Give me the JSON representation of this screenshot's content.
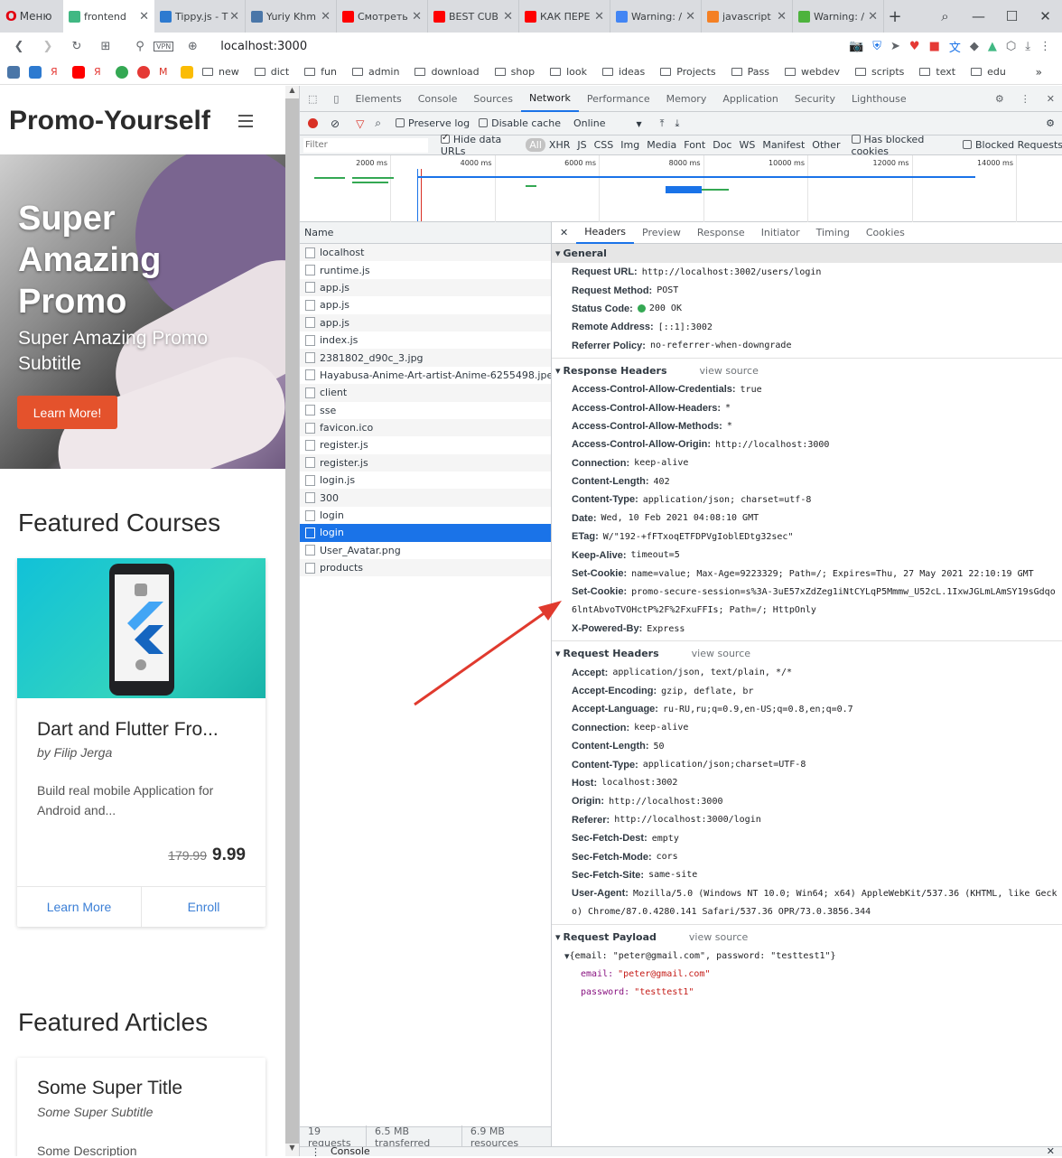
{
  "browser": {
    "menu_label": "Меню",
    "tabs": [
      {
        "title": "frontend",
        "color": "#41b883",
        "active": true
      },
      {
        "title": "Tippy.js - T",
        "color": "#2d7ad0"
      },
      {
        "title": "Yuriy Khm",
        "color": "#4a76a8"
      },
      {
        "title": "Смотреть",
        "color": "#ff0000"
      },
      {
        "title": "BEST CUB",
        "color": "#ff0000"
      },
      {
        "title": "КАК ПЕРЕ",
        "color": "#ff0000"
      },
      {
        "title": "Warning: /",
        "color": "#4285f4"
      },
      {
        "title": "javascript",
        "color": "#f48024"
      },
      {
        "title": "Warning: /",
        "color": "#4db33d"
      }
    ],
    "url": "localhost:3000",
    "vpn_label": "VPN",
    "bookmark_folders": [
      "new",
      "dict",
      "fun",
      "admin",
      "download",
      "shop",
      "look",
      "ideas",
      "Projects",
      "Pass",
      "webdev",
      "scripts",
      "text",
      "edu"
    ]
  },
  "page": {
    "logo": "Promo-Yourself",
    "hero_title": "Super Amazing Promo",
    "hero_subtitle": "Super Amazing Promo Subtitle",
    "hero_button": "Learn More!",
    "courses_heading": "Featured Courses",
    "course": {
      "title": "Dart and Flutter Fro...",
      "author": "by Filip Jerga",
      "description": "Build real mobile Application for Android and...",
      "old_price": "179.99",
      "price": "9.99",
      "learn_more": "Learn More",
      "enroll": "Enroll"
    },
    "articles_heading": "Featured Articles",
    "article": {
      "title": "Some Super Title",
      "subtitle": "Some Super Subtitle",
      "description": "Some Description"
    }
  },
  "devtools": {
    "tabs": [
      "Elements",
      "Console",
      "Sources",
      "Network",
      "Performance",
      "Memory",
      "Application",
      "Security",
      "Lighthouse"
    ],
    "active_tab": "Network",
    "toolbar": {
      "preserve_log": "Preserve log",
      "disable_cache": "Disable cache",
      "throttle": "Online"
    },
    "filter": {
      "placeholder": "Filter",
      "hide_data_urls": "Hide data URLs",
      "types": [
        "All",
        "XHR",
        "JS",
        "CSS",
        "Img",
        "Media",
        "Font",
        "Doc",
        "WS",
        "Manifest",
        "Other"
      ],
      "has_blocked_cookies": "Has blocked cookies",
      "blocked_requests": "Blocked Requests"
    },
    "timeline_ticks": [
      "2000 ms",
      "4000 ms",
      "6000 ms",
      "8000 ms",
      "10000 ms",
      "12000 ms",
      "14000 ms"
    ],
    "name_header": "Name",
    "requests": [
      "localhost",
      "runtime.js",
      "app.js",
      "app.js",
      "app.js",
      "index.js",
      "2381802_d90c_3.jpg",
      "Hayabusa-Anime-Art-artist-Anime-6255498.jpeg",
      "client",
      "sse",
      "favicon.ico",
      "register.js",
      "register.js",
      "login.js",
      "300",
      "login",
      "login",
      "User_Avatar.png",
      "products"
    ],
    "selected_index": 16,
    "summary": {
      "requests": "19 requests",
      "transferred": "6.5 MB transferred",
      "resources": "6.9 MB resources"
    },
    "detail_tabs": [
      "Headers",
      "Preview",
      "Response",
      "Initiator",
      "Timing",
      "Cookies"
    ],
    "active_detail_tab": "Headers",
    "view_source": "view source",
    "general_title": "General",
    "general": [
      {
        "k": "Request URL:",
        "v": "http://localhost:3002/users/login"
      },
      {
        "k": "Request Method:",
        "v": "POST"
      },
      {
        "k": "Status Code:",
        "v": "200 OK",
        "status_dot": "#34a853"
      },
      {
        "k": "Remote Address:",
        "v": "[::1]:3002"
      },
      {
        "k": "Referrer Policy:",
        "v": "no-referrer-when-downgrade"
      }
    ],
    "response_title": "Response Headers",
    "response_headers": [
      {
        "k": "Access-Control-Allow-Credentials:",
        "v": "true"
      },
      {
        "k": "Access-Control-Allow-Headers:",
        "v": "*"
      },
      {
        "k": "Access-Control-Allow-Methods:",
        "v": "*"
      },
      {
        "k": "Access-Control-Allow-Origin:",
        "v": "http://localhost:3000"
      },
      {
        "k": "Connection:",
        "v": "keep-alive"
      },
      {
        "k": "Content-Length:",
        "v": "402"
      },
      {
        "k": "Content-Type:",
        "v": "application/json; charset=utf-8"
      },
      {
        "k": "Date:",
        "v": "Wed, 10 Feb 2021 04:08:10 GMT"
      },
      {
        "k": "ETag:",
        "v": "W/\"192-+fFTxoqETFDPVgIoblEDtg32sec\""
      },
      {
        "k": "Keep-Alive:",
        "v": "timeout=5"
      },
      {
        "k": "Set-Cookie:",
        "v": "name=value; Max-Age=9223329; Path=/; Expires=Thu, 27 May 2021 22:10:19 GMT"
      },
      {
        "k": "Set-Cookie:",
        "v": "promo-secure-session=s%3A-3uE57xZdZeg1iNtCYLqP5Mmmw_U52cL.1IxwJGLmLAmSY19sGdqo"
      },
      {
        "k": "",
        "v": "6lntAbvoTVOHctP%2F%2FxuFFIs; Path=/; HttpOnly"
      },
      {
        "k": "X-Powered-By:",
        "v": "Express"
      }
    ],
    "request_title": "Request Headers",
    "request_headers": [
      {
        "k": "Accept:",
        "v": "application/json, text/plain, */*"
      },
      {
        "k": "Accept-Encoding:",
        "v": "gzip, deflate, br"
      },
      {
        "k": "Accept-Language:",
        "v": "ru-RU,ru;q=0.9,en-US;q=0.8,en;q=0.7"
      },
      {
        "k": "Connection:",
        "v": "keep-alive"
      },
      {
        "k": "Content-Length:",
        "v": "50"
      },
      {
        "k": "Content-Type:",
        "v": "application/json;charset=UTF-8"
      },
      {
        "k": "Host:",
        "v": "localhost:3002"
      },
      {
        "k": "Origin:",
        "v": "http://localhost:3000"
      },
      {
        "k": "Referer:",
        "v": "http://localhost:3000/login"
      },
      {
        "k": "Sec-Fetch-Dest:",
        "v": "empty"
      },
      {
        "k": "Sec-Fetch-Mode:",
        "v": "cors"
      },
      {
        "k": "Sec-Fetch-Site:",
        "v": "same-site"
      },
      {
        "k": "User-Agent:",
        "v": "Mozilla/5.0 (Windows NT 10.0; Win64; x64) AppleWebKit/537.36 (KHTML, like Geck"
      },
      {
        "k": "",
        "v": "o) Chrome/87.0.4280.141 Safari/537.36 OPR/73.0.3856.344"
      }
    ],
    "payload_title": "Request Payload",
    "payload_summary": "{email: \"peter@gmail.com\", password: \"testtest1\"}",
    "payload": [
      {
        "k": "email:",
        "v": "\"peter@gmail.com\""
      },
      {
        "k": "password:",
        "v": "\"testtest1\""
      }
    ],
    "console_label": "Console"
  }
}
